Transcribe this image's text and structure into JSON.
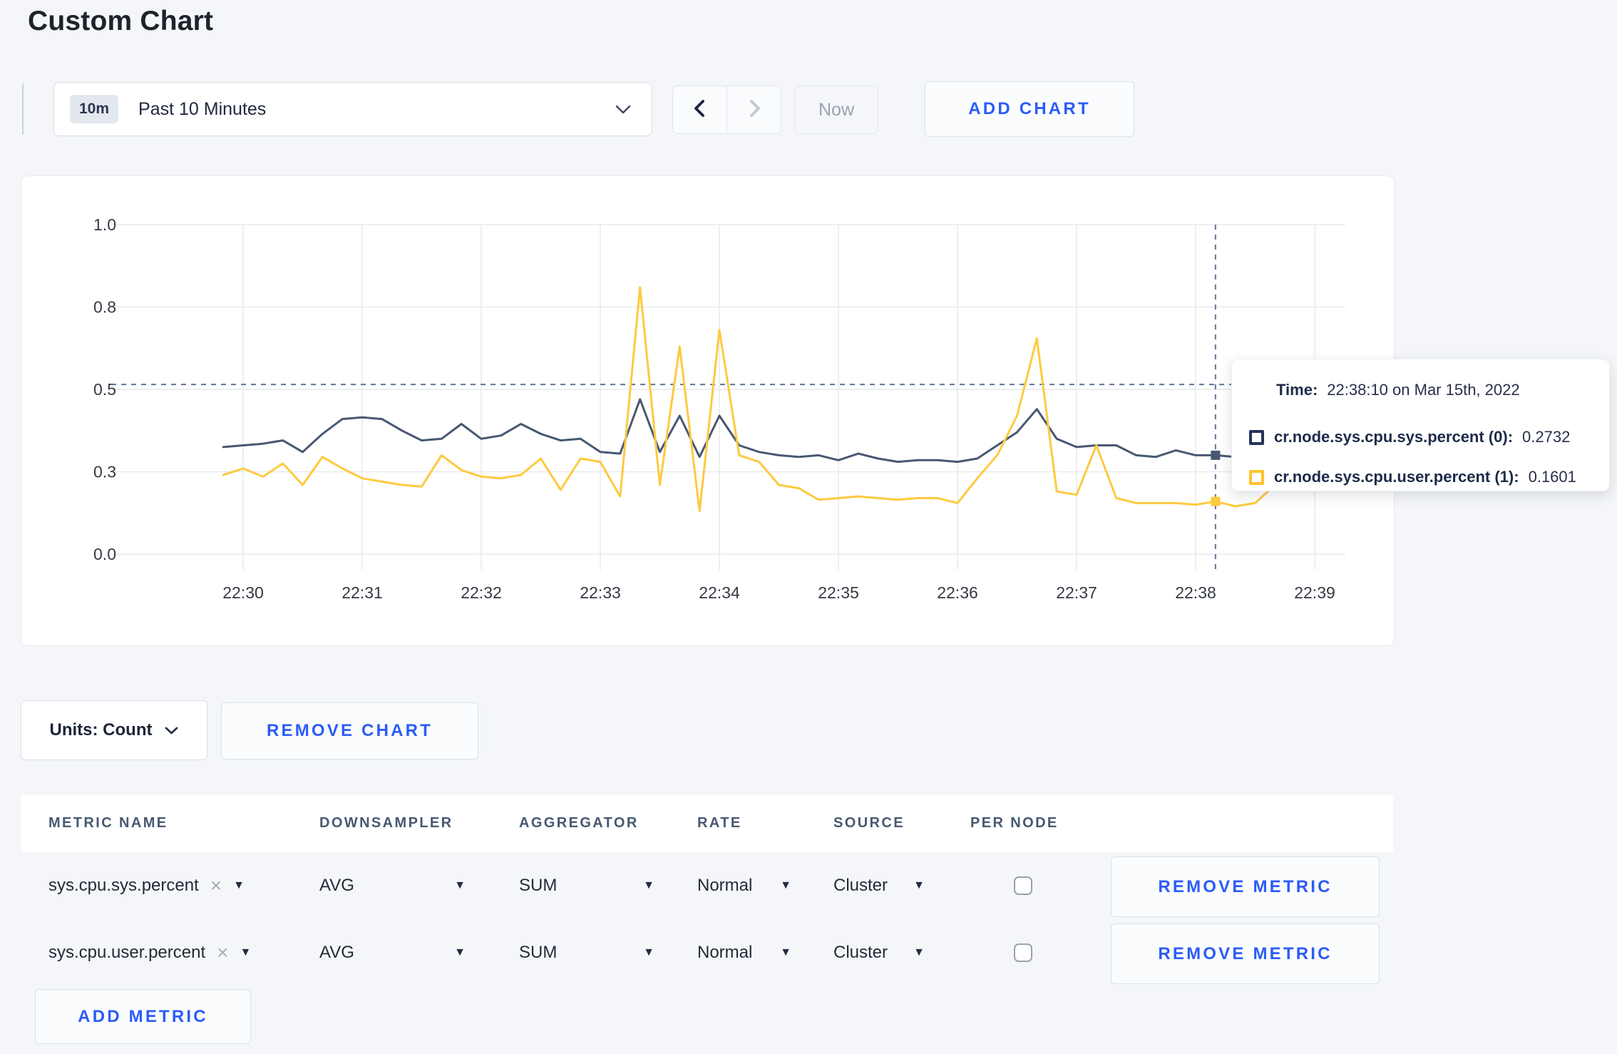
{
  "page": {
    "title": "Custom Chart",
    "background": "#f4f6f9",
    "accent_blue": "#2b5cf6"
  },
  "toolbar": {
    "time_window_badge": "10m",
    "time_window_label": "Past 10 Minutes",
    "prev_icon": "chevron-left",
    "next_icon": "chevron-right",
    "now_label": "Now",
    "add_chart_label": "ADD CHART"
  },
  "tooltip": {
    "time_label": "Time:",
    "time_value": "22:38:10 on Mar 15th, 2022",
    "series": [
      {
        "name": "cr.node.sys.cpu.sys.percent (0):",
        "value": "0.2732",
        "swatch_color": "#24355c"
      },
      {
        "name": "cr.node.sys.cpu.user.percent (1):",
        "value": "0.1601",
        "swatch_color": "#fdc32c"
      }
    ]
  },
  "chart_data": {
    "type": "line",
    "title": "",
    "xlabel": "",
    "ylabel": "",
    "ylim": [
      0,
      1
    ],
    "grid": true,
    "legend_position": "tooltip",
    "x_ticks": [
      "22:30",
      "22:31",
      "22:32",
      "22:33",
      "22:34",
      "22:35",
      "22:36",
      "22:37",
      "22:38",
      "22:39"
    ],
    "y_ticks": [
      "0.0",
      "0.3",
      "0.5",
      "0.8",
      "1.0"
    ],
    "y_tick_values": [
      0,
      0.25,
      0.5,
      0.75,
      1.0
    ],
    "start_time": "22:29:50",
    "start_offset_sec": -10,
    "interval_sec": 10,
    "series": [
      {
        "name": "cr.node.sys.cpu.sys.percent",
        "color": "#475872",
        "values": [
          0.325,
          0.33,
          0.335,
          0.345,
          0.31,
          0.365,
          0.41,
          0.415,
          0.41,
          0.375,
          0.345,
          0.35,
          0.395,
          0.35,
          0.36,
          0.395,
          0.365,
          0.345,
          0.35,
          0.31,
          0.305,
          0.47,
          0.31,
          0.42,
          0.295,
          0.42,
          0.33,
          0.31,
          0.3,
          0.295,
          0.3,
          0.285,
          0.305,
          0.29,
          0.28,
          0.285,
          0.285,
          0.28,
          0.29,
          0.33,
          0.37,
          0.44,
          0.35,
          0.325,
          0.33,
          0.33,
          0.3,
          0.295,
          0.315,
          0.3,
          0.3,
          0.295,
          0.3,
          0.31,
          0.3,
          0.315,
          0.3
        ]
      },
      {
        "name": "cr.node.sys.cpu.user.percent",
        "color": "#fdca40",
        "values": [
          0.24,
          0.26,
          0.235,
          0.275,
          0.21,
          0.295,
          0.26,
          0.23,
          0.22,
          0.21,
          0.205,
          0.3,
          0.255,
          0.235,
          0.23,
          0.24,
          0.29,
          0.195,
          0.29,
          0.28,
          0.175,
          0.81,
          0.21,
          0.63,
          0.13,
          0.68,
          0.3,
          0.28,
          0.21,
          0.2,
          0.165,
          0.17,
          0.175,
          0.17,
          0.165,
          0.17,
          0.17,
          0.155,
          0.23,
          0.3,
          0.42,
          0.655,
          0.19,
          0.18,
          0.33,
          0.17,
          0.155,
          0.155,
          0.155,
          0.15,
          0.16,
          0.145,
          0.155,
          0.21,
          0.285,
          0.23,
          0.27
        ]
      }
    ],
    "crosshair": {
      "x_time": "22:38:10",
      "x_index": 50,
      "y_value": 0.515
    }
  },
  "controls": {
    "units_label": "Units: Count",
    "remove_chart_label": "REMOVE CHART",
    "add_metric_label": "ADD METRIC"
  },
  "table": {
    "headers": [
      "METRIC NAME",
      "DOWNSAMPLER",
      "AGGREGATOR",
      "RATE",
      "SOURCE",
      "PER NODE"
    ],
    "remove_icon": "x-icon",
    "rows": [
      {
        "metric": "sys.cpu.sys.percent",
        "downsampler": "AVG",
        "aggregator": "SUM",
        "rate": "Normal",
        "source": "Cluster",
        "per_node_checked": false,
        "remove_label": "REMOVE METRIC"
      },
      {
        "metric": "sys.cpu.user.percent",
        "downsampler": "AVG",
        "aggregator": "SUM",
        "rate": "Normal",
        "source": "Cluster",
        "per_node_checked": false,
        "remove_label": "REMOVE METRIC"
      }
    ]
  }
}
